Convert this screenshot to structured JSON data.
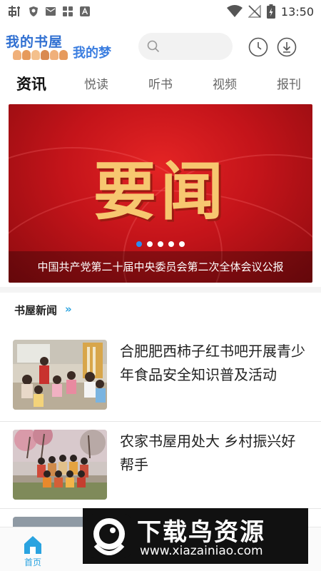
{
  "status_bar": {
    "time": "13:50",
    "left_icons": [
      "carrier-icon",
      "shield-icon",
      "mail-icon",
      "grid-icon",
      "a-icon"
    ],
    "right_icons": [
      "wifi-icon",
      "no-signal-icon",
      "battery-icon"
    ]
  },
  "header": {
    "logo_main": "我的书屋",
    "logo_sub": "我的梦",
    "search_placeholder": "",
    "icons": [
      "clock-icon",
      "download-icon"
    ]
  },
  "tabs": [
    {
      "label": "资讯",
      "active": true
    },
    {
      "label": "悦读",
      "active": false
    },
    {
      "label": "听书",
      "active": false
    },
    {
      "label": "视频",
      "active": false
    },
    {
      "label": "报刊",
      "active": false
    }
  ],
  "banner": {
    "title": "要闻",
    "caption": "中国共产党第二十届中央委员会第二次全体会议公报",
    "slide_count": 5,
    "active_slide": 1
  },
  "section": {
    "title": "书屋新闻",
    "arrow": "»"
  },
  "news": [
    {
      "title": "合肥肥西柿子红书吧开展青少年食品安全知识普及活动"
    },
    {
      "title": "农家书屋用处大 乡村振兴好帮手"
    }
  ],
  "bottom_nav": {
    "home_label": "首页"
  },
  "watermark": {
    "title": "下载鸟资源",
    "url": "www.xiazainiao.com"
  },
  "colors": {
    "accent": "#2aa3e0",
    "banner_red": "#c4141a",
    "banner_gold": "#f7c770"
  }
}
